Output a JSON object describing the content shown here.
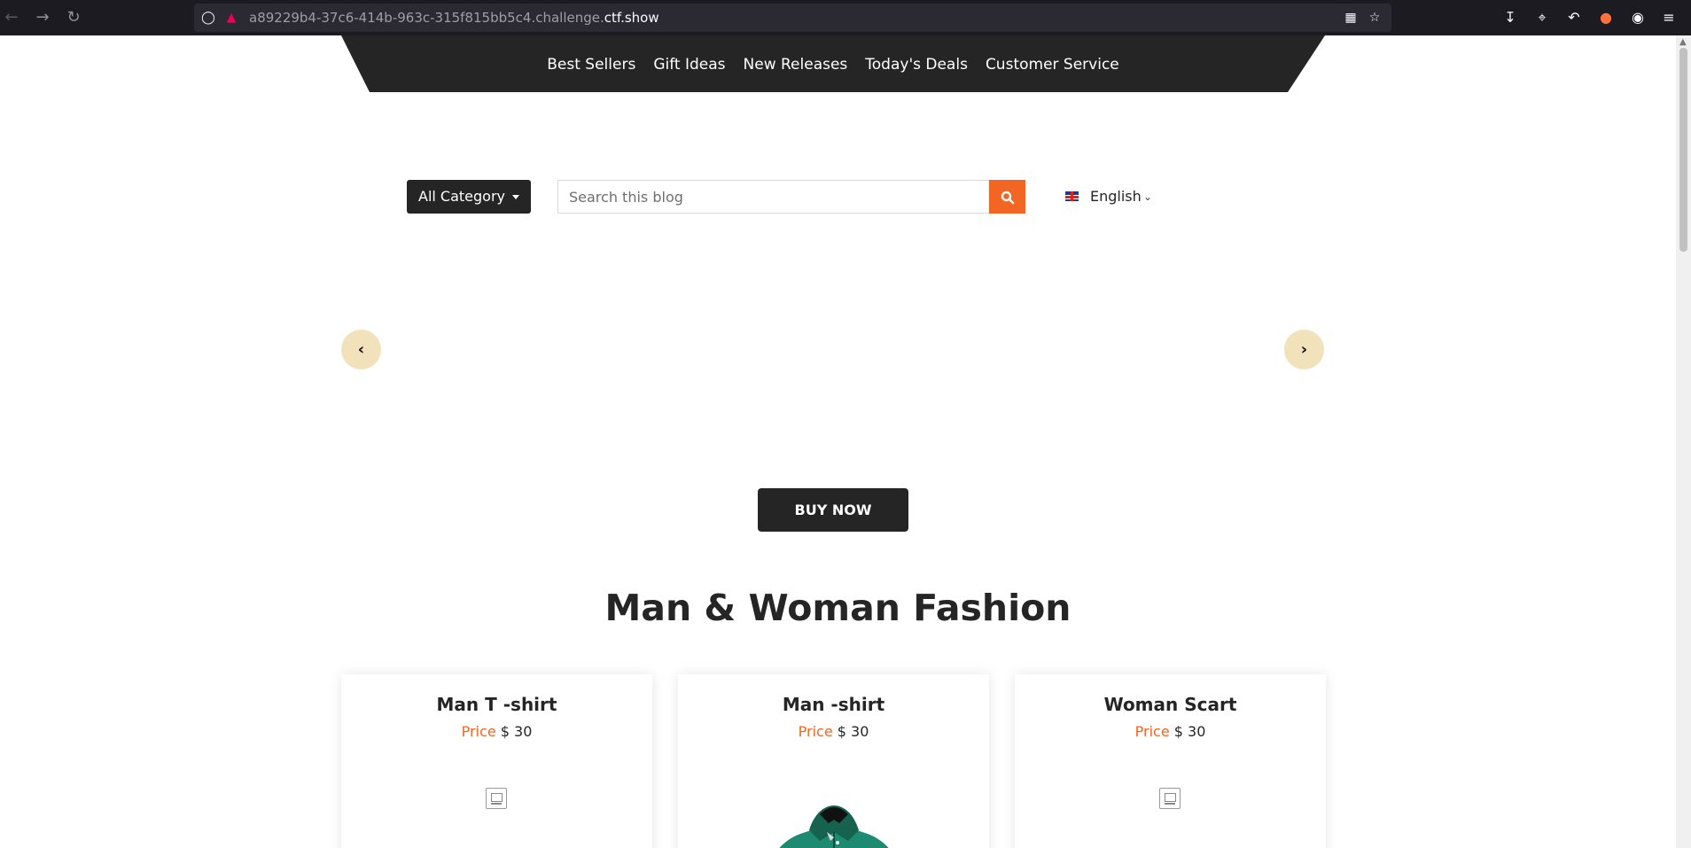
{
  "browser": {
    "url_prefix": "a89229b4-37c6-414b-963c-315f815bb5c4.challenge.",
    "url_domain": "ctf.show"
  },
  "nav": {
    "items": [
      "Best Sellers",
      "Gift Ideas",
      "New Releases",
      "Today's Deals",
      "Customer Service"
    ]
  },
  "search": {
    "category_label": "All Category",
    "placeholder": "Search this blog",
    "language": "English"
  },
  "hero": {
    "buy_label": "BUY NOW"
  },
  "section": {
    "title": "Man & Woman Fashion"
  },
  "products": [
    {
      "name": "Man T -shirt",
      "price_label": "Price",
      "price": "$ 30"
    },
    {
      "name": "Man -shirt",
      "price_label": "Price",
      "price": "$ 30"
    },
    {
      "name": "Woman Scart",
      "price_label": "Price",
      "price": "$ 30"
    }
  ],
  "colors": {
    "accent": "#f26522",
    "dark": "#252525",
    "arrow_bg": "#f2e2bc",
    "shirt": "#1f8a72"
  }
}
